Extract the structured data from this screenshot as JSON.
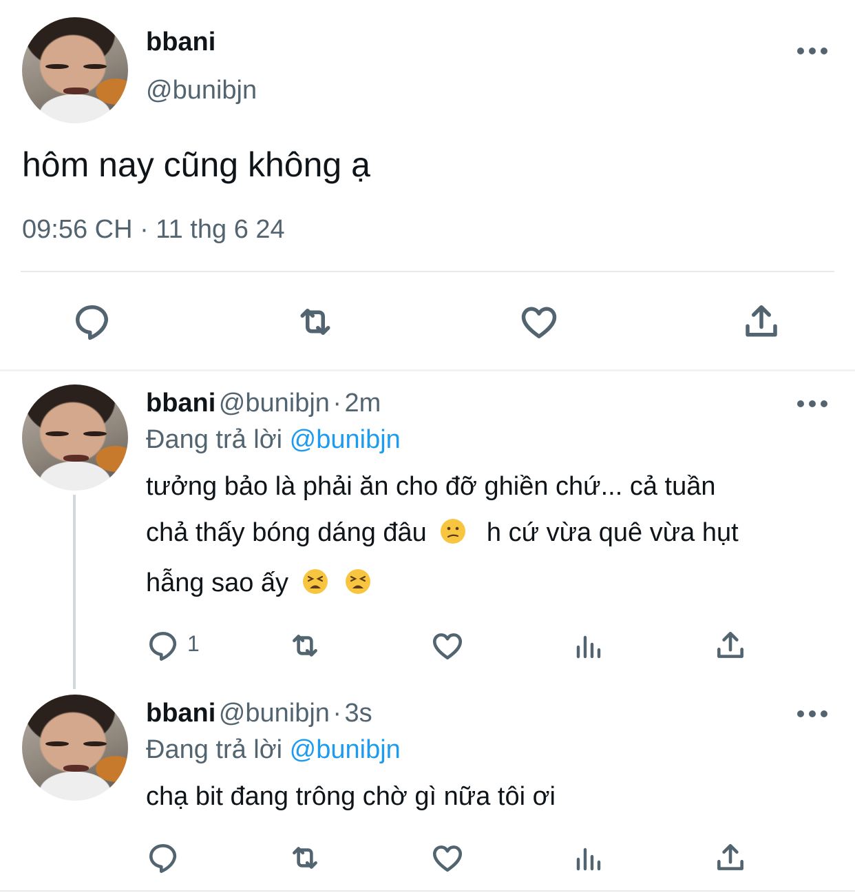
{
  "main_tweet": {
    "display_name": "bbani",
    "handle": "@bunibjn",
    "text": "hôm nay cũng không ạ",
    "timestamp": "09:56 CH · 11 thg 6 24",
    "actions": [
      "reply-icon",
      "retweet-icon",
      "like-icon",
      "share-icon"
    ]
  },
  "replies": [
    {
      "display_name": "bbani",
      "handle": "@bunibjn",
      "separator": "·",
      "time": "2m",
      "replying_label": "Đang trả lời",
      "replying_to": "@bunibjn",
      "text_line1": "tưởng bảo là phải ăn cho đỡ ghiền chứ... cả tuần",
      "text_line2a": "chả thấy bóng dáng đâu",
      "text_line2b": "h cứ vừa quê vừa hụt",
      "text_line3": "hẫng sao ấy",
      "reply_count": "1",
      "emojis": [
        "confused-face",
        "tired-face",
        "tired-face"
      ]
    },
    {
      "display_name": "bbani",
      "handle": "@bunibjn",
      "separator": "·",
      "time": "3s",
      "replying_label": "Đang trả lời",
      "replying_to": "@bunibjn",
      "text": "chạ bit đang trông chờ gì nữa tôi ơi",
      "reply_count": ""
    }
  ],
  "colors": {
    "text": "#0f1419",
    "secondary": "#536471",
    "link": "#1d9bf0",
    "divider": "#e7e9ea"
  }
}
